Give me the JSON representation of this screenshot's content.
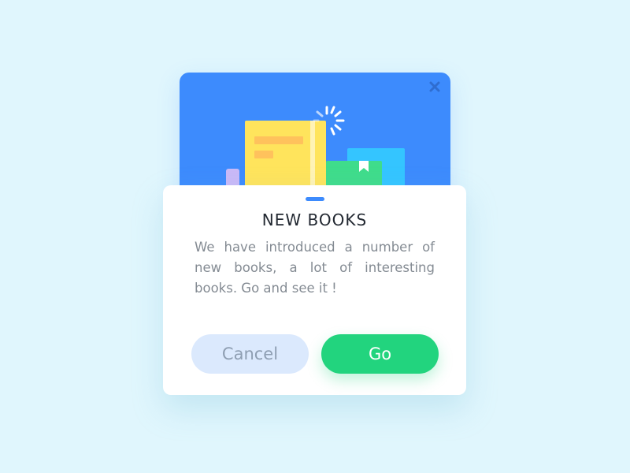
{
  "dialog": {
    "title": "NEW BOOKS",
    "message": "We have introduced a number of new books, a lot of interesting books. Go and see it !",
    "cancel_label": "Cancel",
    "go_label": "Go"
  },
  "icons": {
    "close": "close-icon",
    "illustration": "books-illustration",
    "spinner": "loading-spinner-icon",
    "bookmark": "bookmark-icon"
  },
  "colors": {
    "background": "#e0f6fd",
    "header": "#3d8bfd",
    "primary": "#22d47e",
    "secondary": "#dbe9fd",
    "title": "#222831",
    "text": "#848b93"
  }
}
